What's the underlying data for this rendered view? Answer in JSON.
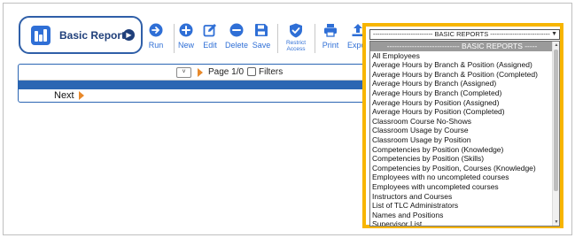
{
  "report_pill": {
    "title": "Basic Reports",
    "chevron": "▶"
  },
  "toolbar": {
    "run": "Run",
    "new": "New",
    "edit": "Edit",
    "delete": "Delete",
    "save": "Save",
    "restrict_access": "Restrict Access",
    "print": "Print",
    "export": "Export"
  },
  "viewer": {
    "page_select": "˅",
    "page_label": "Page 1/0",
    "filters_label": "Filters",
    "next_label": "Next"
  },
  "dropdown": {
    "selected_value": "--------------------------- BASIC REPORTS ---------------------------",
    "options": [
      "----------------------------- BASIC REPORTS -----",
      "All Employees",
      "Average Hours by Branch & Position (Assigned)",
      "Average Hours by Branch & Position (Completed)",
      "Average Hours by Branch (Assigned)",
      "Average Hours by Branch (Completed)",
      "Average Hours by Position (Assigned)",
      "Average Hours by Position (Completed)",
      "Classroom Course No-Shows",
      "Classroom Usage by Course",
      "Classroom Usage by Position",
      "Competencies by Position (Knowledge)",
      "Competencies by Position (Skills)",
      "Competencies by Position, Courses (Knowledge)",
      "Employees with no uncompleted courses",
      "Employees with uncompleted courses",
      "Instructors and Courses",
      "List of TLC Administrators",
      "Names and Positions",
      "Supervisor List"
    ]
  },
  "colors": {
    "accent_blue": "#2f6fd6",
    "highlight_yellow": "#f7b500",
    "arrow_orange": "#e8892b"
  },
  "icons": {
    "run": "arrow-right-circle-icon",
    "new": "plus-circle-icon",
    "edit": "pencil-square-icon",
    "delete": "minus-circle-icon",
    "save": "floppy-disk-icon",
    "restrict": "shield-check-icon",
    "print": "printer-icon",
    "export": "upload-icon"
  }
}
